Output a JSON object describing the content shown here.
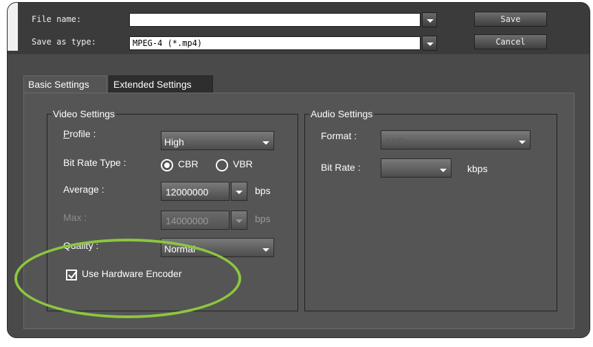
{
  "top": {
    "file_name_label": "File name:",
    "file_name_value": "",
    "save_as_type_label": "Save as type:",
    "save_as_type_value": "MPEG-4 (*.mp4)",
    "save_button": "Save",
    "cancel_button": "Cancel"
  },
  "tabs": [
    "Basic Settings",
    "Extended Settings"
  ],
  "video": {
    "title": "Video Settings",
    "profile_label": "Profile :",
    "profile_value": "High",
    "bitrate_type_label": "Bit Rate Type :",
    "cbr_label": "CBR",
    "vbr_label": "VBR",
    "selected_bitrate_type": "CBR",
    "average_label": "Average :",
    "average_value": "12000000",
    "average_unit": "bps",
    "max_label": "Max :",
    "max_value": "14000000",
    "max_unit": "bps",
    "quality_label": "Quality :",
    "quality_value": "Normal",
    "hardware_encoder_label": "Use Hardware Encoder",
    "hardware_encoder_checked": true
  },
  "audio": {
    "title": "Audio Settings",
    "format_label": "Format :",
    "format_value": "AAC",
    "bitrate_label": "Bit Rate :",
    "bitrate_value": "",
    "bitrate_unit": "kbps"
  },
  "colors": {
    "highlight": "#8cc63f",
    "dialog_bg": "#4a4a4a",
    "panel_bg": "#555555"
  }
}
